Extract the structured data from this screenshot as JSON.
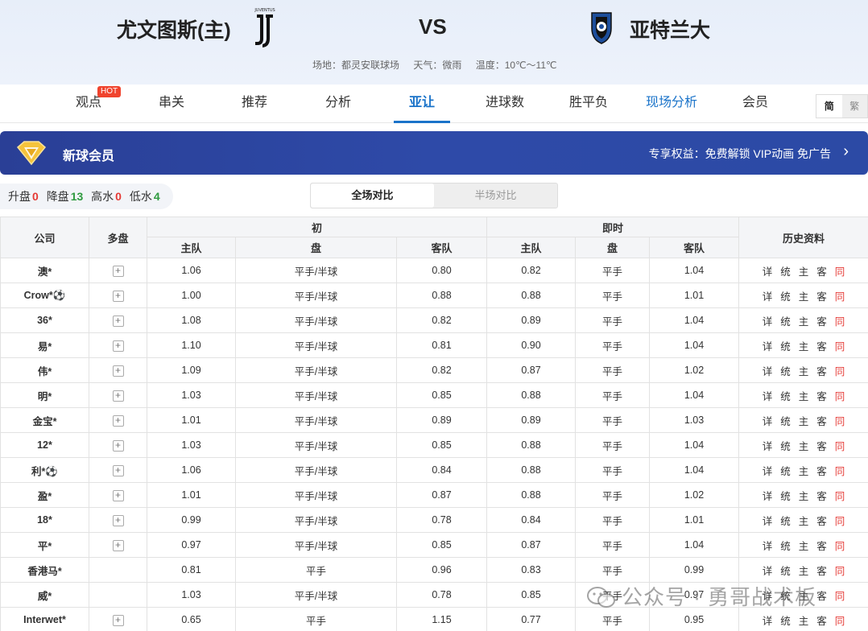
{
  "match": {
    "home_team": "尤文图斯(主)",
    "vs": "VS",
    "away_team": "亚特兰大",
    "venue": "场地：都灵安联球场",
    "weather": "天气：微雨",
    "temperature": "温度：10℃～11℃"
  },
  "nav": {
    "tabs": [
      "观点",
      "串关",
      "推荐",
      "分析",
      "亚让",
      "进球数",
      "胜平负",
      "现场分析",
      "会员"
    ],
    "active": "亚让",
    "hot_badge": "HOT",
    "lang_simp": "简",
    "lang_trad": "繁"
  },
  "vip": {
    "title": "新球会员",
    "perks": "专享权益：免费解锁 VIP动画 免广告"
  },
  "summary": {
    "up_label": "升盘",
    "up_count": "0",
    "down_label": "降盘",
    "down_count": "13",
    "high_label": "高水",
    "high_count": "0",
    "low_label": "低水",
    "low_count": "4"
  },
  "toggle": {
    "full": "全场对比",
    "half": "半场对比"
  },
  "table": {
    "headers": {
      "company": "公司",
      "multi": "多盘",
      "initial": "初",
      "live": "即时",
      "history": "历史资料",
      "home": "主队",
      "line": "盘",
      "away": "客队"
    },
    "history_labels": [
      "详",
      "统",
      "主",
      "客",
      "同"
    ],
    "rows": [
      {
        "company": "澳*",
        "plus": true,
        "i_home": "1.06",
        "i_line": "平手/半球",
        "i_away": "0.80",
        "l_home": "0.82",
        "l_line": "平手",
        "l_away": "1.04"
      },
      {
        "company": "Crow*⚽",
        "plus": true,
        "i_home": "1.00",
        "i_line": "平手/半球",
        "i_away": "0.88",
        "l_home": "0.88",
        "l_line": "平手",
        "l_away": "1.01"
      },
      {
        "company": "36*",
        "plus": true,
        "i_home": "1.08",
        "i_line": "平手/半球",
        "i_away": "0.82",
        "l_home": "0.89",
        "l_line": "平手",
        "l_away": "1.04"
      },
      {
        "company": "易*",
        "plus": true,
        "i_home": "1.10",
        "i_line": "平手/半球",
        "i_away": "0.81",
        "l_home": "0.90",
        "l_line": "平手",
        "l_away": "1.04"
      },
      {
        "company": "伟*",
        "plus": true,
        "i_home": "1.09",
        "i_line": "平手/半球",
        "i_away": "0.82",
        "l_home": "0.87",
        "l_line": "平手",
        "l_away": "1.02"
      },
      {
        "company": "明*",
        "plus": true,
        "i_home": "1.03",
        "i_line": "平手/半球",
        "i_away": "0.85",
        "l_home": "0.88",
        "l_line": "平手",
        "l_away": "1.04"
      },
      {
        "company": "金宝*",
        "plus": true,
        "i_home": "1.01",
        "i_line": "平手/半球",
        "i_away": "0.89",
        "l_home": "0.89",
        "l_line": "平手",
        "l_away": "1.03"
      },
      {
        "company": "12*",
        "plus": true,
        "i_home": "1.03",
        "i_line": "平手/半球",
        "i_away": "0.85",
        "l_home": "0.88",
        "l_line": "平手",
        "l_away": "1.04"
      },
      {
        "company": "利*⚽",
        "plus": true,
        "i_home": "1.06",
        "i_line": "平手/半球",
        "i_away": "0.84",
        "l_home": "0.88",
        "l_line": "平手",
        "l_away": "1.04"
      },
      {
        "company": "盈*",
        "plus": true,
        "i_home": "1.01",
        "i_line": "平手/半球",
        "i_away": "0.87",
        "l_home": "0.88",
        "l_line": "平手",
        "l_away": "1.02"
      },
      {
        "company": "18*",
        "plus": true,
        "i_home": "0.99",
        "i_line": "平手/半球",
        "i_away": "0.78",
        "l_home": "0.84",
        "l_line": "平手",
        "l_away": "1.01"
      },
      {
        "company": "平*",
        "plus": true,
        "i_home": "0.97",
        "i_line": "平手/半球",
        "i_away": "0.85",
        "l_home": "0.87",
        "l_line": "平手",
        "l_away": "1.04"
      },
      {
        "company": "香港马*",
        "plus": false,
        "i_home": "0.81",
        "i_line": "平手",
        "i_away": "0.96",
        "l_home": "0.83",
        "l_line": "平手",
        "l_away": "0.99"
      },
      {
        "company": "威*",
        "plus": false,
        "i_home": "1.03",
        "i_line": "平手/半球",
        "i_away": "0.78",
        "l_home": "0.85",
        "l_line": "平手",
        "l_away": "0.97"
      },
      {
        "company": "Interwet*",
        "plus": true,
        "i_home": "0.65",
        "i_line": "平手",
        "i_away": "1.15",
        "l_home": "0.77",
        "l_line": "平手",
        "l_away": "0.95"
      }
    ]
  },
  "watermark": "公众号 · 勇哥战术板"
}
